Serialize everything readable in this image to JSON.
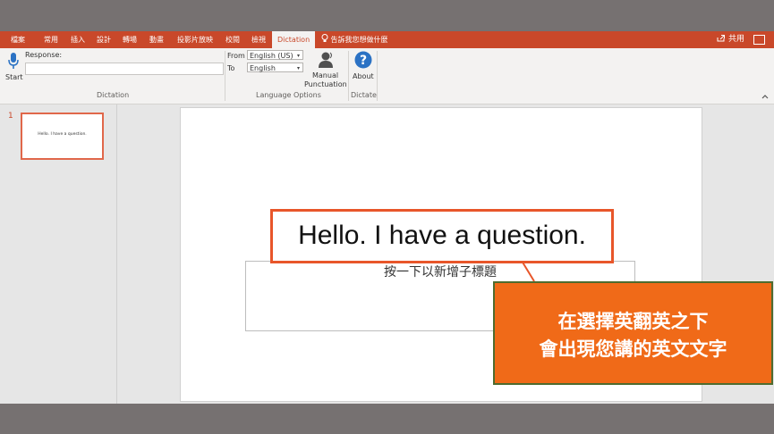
{
  "tabs": [
    "檔案",
    "常用",
    "插入",
    "設計",
    "轉場",
    "動畫",
    "投影片放映",
    "校閱",
    "檢視",
    "Dictation"
  ],
  "tell_me": "告訴我您想做什麼",
  "share_label": "共用",
  "ribbon": {
    "start_label": "Start",
    "response_label": "Response:",
    "response_value": "",
    "from_label": "From",
    "to_label": "To",
    "from_value": "English (US)",
    "to_value": "English",
    "manual_label_1": "Manual",
    "manual_label_2": "Punctuation",
    "about_label": "About",
    "groups": {
      "dictation": "Dictation",
      "language": "Language Options",
      "dictate": "Dictate"
    }
  },
  "slides_pane": {
    "number": "1",
    "thumb_text": "Hello. I have a question."
  },
  "slide": {
    "placeholder": "按一下以新增子標題"
  },
  "callout": {
    "text": "Hello. I have a question."
  },
  "note": {
    "line1": "在選擇英翻英之下",
    "line2": "會出現您講的英文文字"
  },
  "colors": {
    "accent": "#c9482a",
    "note_fill": "#f06a18",
    "callout_border": "#e8562a"
  }
}
